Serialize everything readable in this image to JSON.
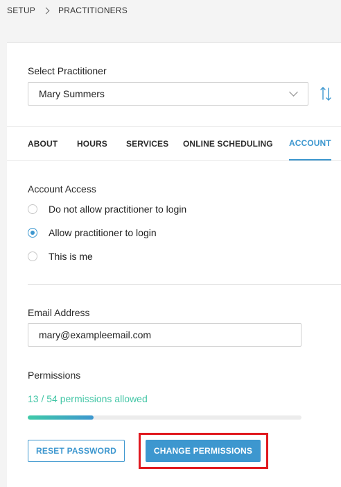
{
  "breadcrumb": {
    "root": "SETUP",
    "current": "PRACTITIONERS"
  },
  "practitioner": {
    "label": "Select Practitioner",
    "selected": "Mary Summers"
  },
  "tabs": [
    {
      "label": "ABOUT"
    },
    {
      "label": "HOURS"
    },
    {
      "label": "SERVICES"
    },
    {
      "label": "ONLINE SCHEDULING"
    },
    {
      "label": "ACCOUNT"
    }
  ],
  "account_access": {
    "title": "Account Access",
    "options": [
      {
        "label": "Do not allow practitioner to login",
        "checked": false
      },
      {
        "label": "Allow practitioner to login",
        "checked": true
      },
      {
        "label": "This is me",
        "checked": false
      }
    ]
  },
  "email": {
    "label": "Email Address",
    "value": "mary@exampleemail.com"
  },
  "permissions": {
    "label": "Permissions",
    "summary": "13 / 54 permissions allowed",
    "allowed": 13,
    "total": 54
  },
  "buttons": {
    "reset": "RESET PASSWORD",
    "change": "CHANGE PERMISSIONS"
  },
  "colors": {
    "accent": "#3d97cf",
    "success": "#43c6a6",
    "highlight": "#e0191f"
  }
}
